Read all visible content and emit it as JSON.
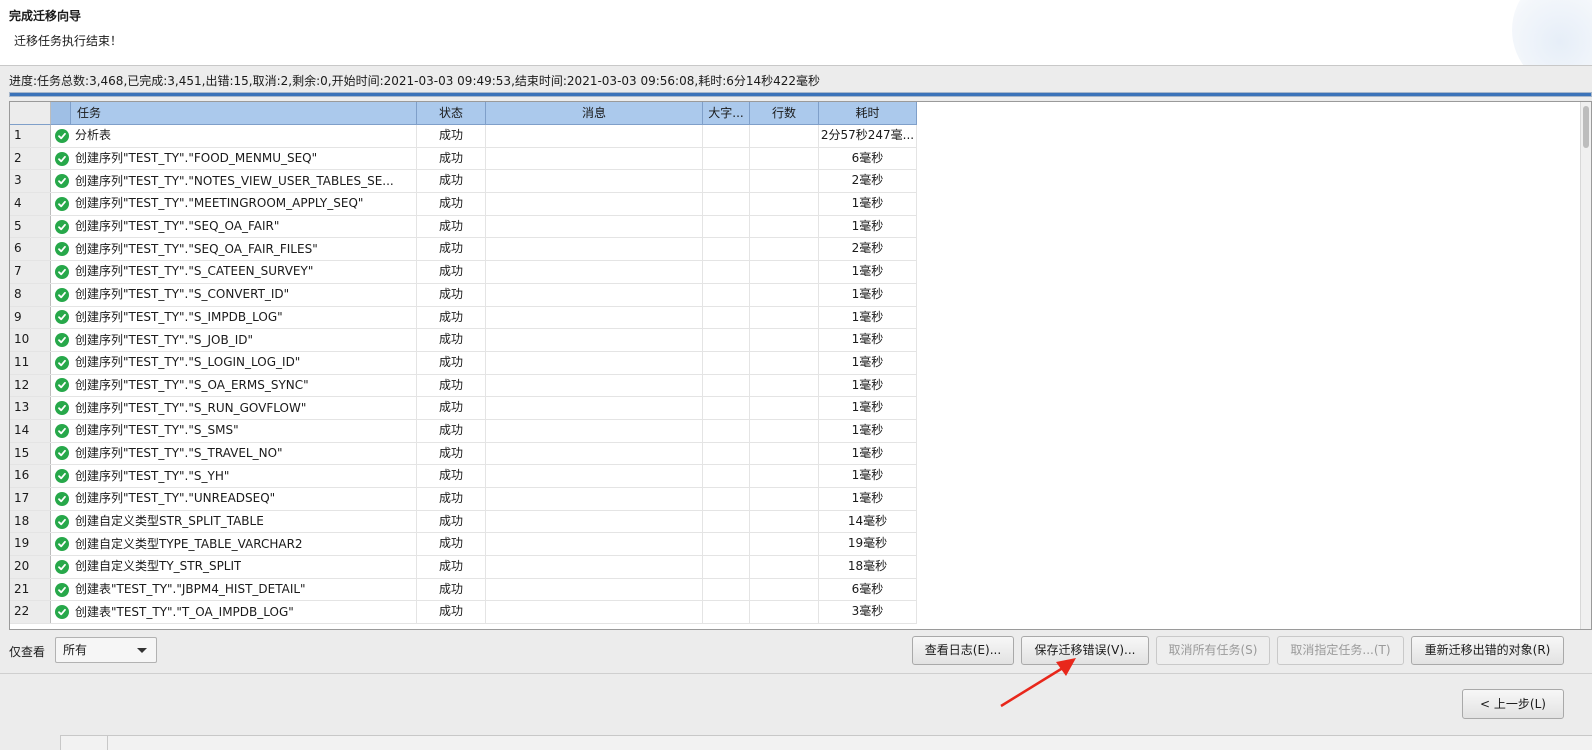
{
  "header": {
    "title": "完成迁移向导",
    "subtitle": "迁移任务执行结束！"
  },
  "progress": {
    "text": "进度:任务总数:3,468,已完成:3,451,出错:15,取消:2,剩余:0,开始时间:2021-03-03 09:49:53,结束时间:2021-03-03 09:56:08,耗时:6分14秒422毫秒",
    "fraction": 1.0
  },
  "table": {
    "columns": {
      "task": "任务",
      "status": "状态",
      "message": "消息",
      "size": "大字...",
      "rows": "行数",
      "time": "耗时"
    },
    "rows": [
      {
        "n": "1",
        "task": "分析表",
        "status": "成功",
        "time": "2分57秒247毫..."
      },
      {
        "n": "2",
        "task": "创建序列\"TEST_TY\".\"FOOD_MENMU_SEQ\"",
        "status": "成功",
        "time": "6毫秒"
      },
      {
        "n": "3",
        "task": "创建序列\"TEST_TY\".\"NOTES_VIEW_USER_TABLES_SE...",
        "status": "成功",
        "time": "2毫秒"
      },
      {
        "n": "4",
        "task": "创建序列\"TEST_TY\".\"MEETINGROOM_APPLY_SEQ\"",
        "status": "成功",
        "time": "1毫秒"
      },
      {
        "n": "5",
        "task": "创建序列\"TEST_TY\".\"SEQ_OA_FAIR\"",
        "status": "成功",
        "time": "1毫秒"
      },
      {
        "n": "6",
        "task": "创建序列\"TEST_TY\".\"SEQ_OA_FAIR_FILES\"",
        "status": "成功",
        "time": "2毫秒"
      },
      {
        "n": "7",
        "task": "创建序列\"TEST_TY\".\"S_CATEEN_SURVEY\"",
        "status": "成功",
        "time": "1毫秒"
      },
      {
        "n": "8",
        "task": "创建序列\"TEST_TY\".\"S_CONVERT_ID\"",
        "status": "成功",
        "time": "1毫秒"
      },
      {
        "n": "9",
        "task": "创建序列\"TEST_TY\".\"S_IMPDB_LOG\"",
        "status": "成功",
        "time": "1毫秒"
      },
      {
        "n": "10",
        "task": "创建序列\"TEST_TY\".\"S_JOB_ID\"",
        "status": "成功",
        "time": "1毫秒"
      },
      {
        "n": "11",
        "task": "创建序列\"TEST_TY\".\"S_LOGIN_LOG_ID\"",
        "status": "成功",
        "time": "1毫秒"
      },
      {
        "n": "12",
        "task": "创建序列\"TEST_TY\".\"S_OA_ERMS_SYNC\"",
        "status": "成功",
        "time": "1毫秒"
      },
      {
        "n": "13",
        "task": "创建序列\"TEST_TY\".\"S_RUN_GOVFLOW\"",
        "status": "成功",
        "time": "1毫秒"
      },
      {
        "n": "14",
        "task": "创建序列\"TEST_TY\".\"S_SMS\"",
        "status": "成功",
        "time": "1毫秒"
      },
      {
        "n": "15",
        "task": "创建序列\"TEST_TY\".\"S_TRAVEL_NO\"",
        "status": "成功",
        "time": "1毫秒"
      },
      {
        "n": "16",
        "task": "创建序列\"TEST_TY\".\"S_YH\"",
        "status": "成功",
        "time": "1毫秒"
      },
      {
        "n": "17",
        "task": "创建序列\"TEST_TY\".\"UNREADSEQ\"",
        "status": "成功",
        "time": "1毫秒"
      },
      {
        "n": "18",
        "task": "创建自定义类型STR_SPLIT_TABLE",
        "status": "成功",
        "time": "14毫秒"
      },
      {
        "n": "19",
        "task": "创建自定义类型TYPE_TABLE_VARCHAR2",
        "status": "成功",
        "time": "19毫秒"
      },
      {
        "n": "20",
        "task": "创建自定义类型TY_STR_SPLIT",
        "status": "成功",
        "time": "18毫秒"
      },
      {
        "n": "21",
        "task": "创建表\"TEST_TY\".\"JBPM4_HIST_DETAIL\"",
        "status": "成功",
        "time": "6毫秒"
      },
      {
        "n": "22",
        "task": "创建表\"TEST_TY\".\"T_OA_IMPDB_LOG\"",
        "status": "成功",
        "time": "3毫秒"
      }
    ]
  },
  "filter": {
    "label": "仅查看",
    "value": "所有"
  },
  "buttons": {
    "view_log": "查看日志(E)...",
    "save_errors": "保存迁移错误(V)...",
    "cancel_all": "取消所有任务(S)",
    "cancel_selected": "取消指定任务...(T)",
    "remigrate": "重新迁移出错的对象(R)",
    "back": "< 上一步(L)"
  },
  "colors": {
    "header_blue": "#abc9ec",
    "success_green": "#27a84a",
    "progress_blue": "#3b73b9",
    "arrow_red": "#e8271b"
  },
  "icons": {
    "success": "check-circle-icon",
    "dropdown": "chevron-down-icon",
    "annotation": "red-arrow-icon"
  }
}
